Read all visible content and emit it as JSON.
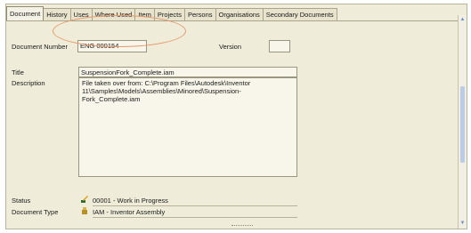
{
  "tabs": [
    {
      "label": "Document"
    },
    {
      "label": "History"
    },
    {
      "label": "Uses"
    },
    {
      "label": "Where Used"
    },
    {
      "label": "Item"
    },
    {
      "label": "Projects"
    },
    {
      "label": "Persons"
    },
    {
      "label": "Organisations"
    },
    {
      "label": "Secondary Documents"
    }
  ],
  "document": {
    "number_label": "Document Number",
    "number_value": "ENG 000154",
    "version_label": "Version",
    "version_value": "",
    "title_label": "Title",
    "title_value": "SuspensionFork_Complete.iam",
    "description_label": "Description",
    "description_value": "File taken over from: C:\\Program Files\\Autodesk\\Inventor 11\\Samples\\Models\\Assemblies\\Minored\\Suspension-Fork_Complete.iam",
    "status_label": "Status",
    "status_value": "00001 - Work in Progress",
    "status_icon": "pencil-status-icon",
    "type_label": "Document Type",
    "type_value": "IAM - Inventor Assembly",
    "type_icon": "assembly-icon"
  },
  "colors": {
    "annotation": "#e8976b",
    "panel": "#efecd9"
  }
}
